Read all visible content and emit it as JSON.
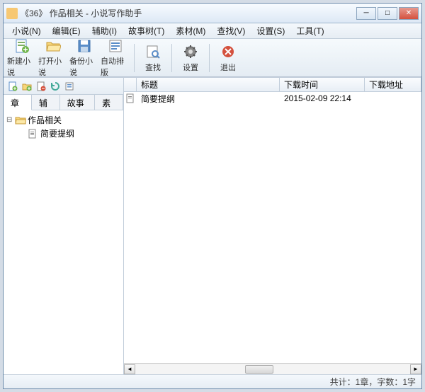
{
  "titlebar": {
    "text": "《36》 作品相关 - 小说写作助手"
  },
  "menu": {
    "items": [
      {
        "label": "小说(N)"
      },
      {
        "label": "编辑(E)"
      },
      {
        "label": "辅助(I)"
      },
      {
        "label": "故事树(T)"
      },
      {
        "label": "素材(M)"
      },
      {
        "label": "查找(V)"
      },
      {
        "label": "设置(S)"
      },
      {
        "label": "工具(T)"
      }
    ]
  },
  "toolbar": {
    "buttons": [
      {
        "label": "新建小说",
        "icon": "new-doc"
      },
      {
        "label": "打开小说",
        "icon": "open-folder"
      },
      {
        "label": "备份小说",
        "icon": "save"
      },
      {
        "label": "自动排版",
        "icon": "layout"
      }
    ],
    "buttons2": [
      {
        "label": "查找",
        "icon": "search"
      }
    ],
    "buttons3": [
      {
        "label": "设置",
        "icon": "gear"
      }
    ],
    "buttons4": [
      {
        "label": "退出",
        "icon": "exit"
      }
    ]
  },
  "left": {
    "tabs": [
      {
        "label": "章节"
      },
      {
        "label": "辅助"
      },
      {
        "label": "故事树"
      },
      {
        "label": "素材"
      }
    ],
    "active_tab": 0,
    "tree": {
      "root": {
        "label": "作品相关",
        "icon": "folder-open"
      },
      "child": {
        "label": "简要提纲",
        "icon": "doc"
      }
    }
  },
  "list": {
    "columns": [
      {
        "label": ""
      },
      {
        "label": "标题"
      },
      {
        "label": "下载时间"
      },
      {
        "label": "下载地址"
      }
    ],
    "rows": [
      {
        "title": "简要提纲",
        "time": "2015-02-09 22:14",
        "url": ""
      }
    ]
  },
  "statusbar": {
    "text": "共计：1章，字数：1字"
  }
}
